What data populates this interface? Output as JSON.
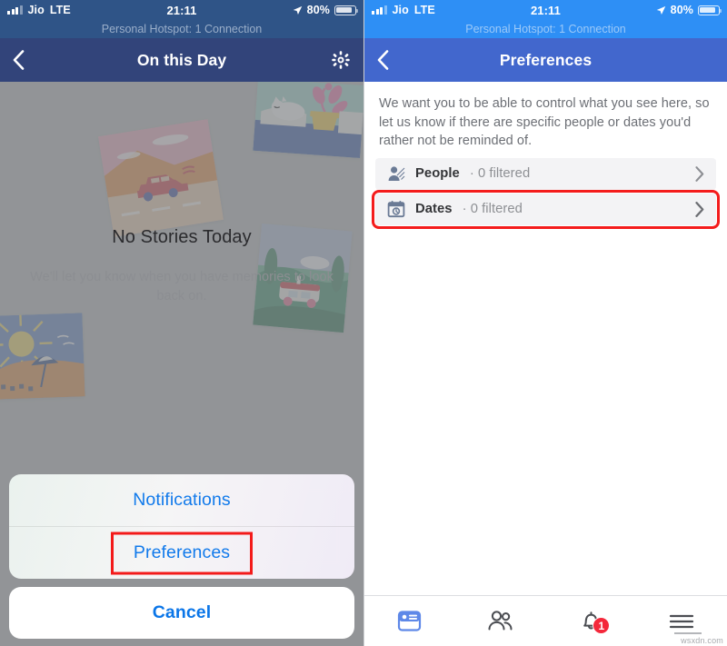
{
  "status_bar": {
    "carrier": "Jio",
    "network": "LTE",
    "time": "21:11",
    "battery_percent": "80%",
    "hotspot_text": "Personal Hotspot: 1 Connection"
  },
  "left_screen": {
    "nav": {
      "back_icon": "chevron-left-icon",
      "title": "On this Day",
      "settings_icon": "gear-icon"
    },
    "empty_state": {
      "title": "No Stories Today",
      "subtitle": "We'll let you know when you have memories to look back on."
    },
    "action_sheet": {
      "items": [
        {
          "label": "Notifications",
          "highlighted": false
        },
        {
          "label": "Preferences",
          "highlighted": true
        }
      ],
      "cancel_label": "Cancel"
    },
    "illustrations": [
      {
        "name": "car-desert-card"
      },
      {
        "name": "cat-plant-card"
      },
      {
        "name": "van-forest-card"
      },
      {
        "name": "beach-umbrella-card"
      }
    ]
  },
  "right_screen": {
    "nav": {
      "back_icon": "chevron-left-icon",
      "title": "Preferences"
    },
    "description": "We want you to be able to control what you see here, so let us know if there are specific people or dates you'd rather not be reminded of.",
    "rows": [
      {
        "icon": "people-filtered-icon",
        "label": "People",
        "meta": "· 0 filtered",
        "highlighted": false
      },
      {
        "icon": "calendar-icon",
        "label": "Dates",
        "meta": "· 0 filtered",
        "highlighted": true
      }
    ],
    "tabbar": [
      {
        "name": "news-feed",
        "icon": "news-feed-icon",
        "active": true,
        "badge": ""
      },
      {
        "name": "friends",
        "icon": "friends-icon",
        "active": false,
        "badge": ""
      },
      {
        "name": "notifications",
        "icon": "bell-icon",
        "active": false,
        "badge": "1"
      },
      {
        "name": "menu",
        "icon": "hamburger-menu-icon",
        "active": false,
        "badge": ""
      }
    ]
  },
  "watermark": "wsxdn.com",
  "colors": {
    "left_status_bg": "#2f5487",
    "left_nav_bg": "#32447a",
    "right_status_bg": "#2e8ff5",
    "right_nav_bg": "#4267cd",
    "ios_blue": "#117aeb",
    "highlight_red": "#f31a1a",
    "badge_red": "#f4283b"
  }
}
